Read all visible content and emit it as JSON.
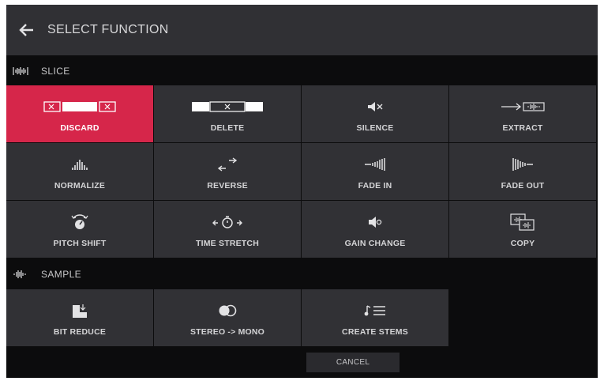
{
  "header": {
    "title": "SELECT FUNCTION",
    "back_icon": "arrow-left-icon"
  },
  "slice": {
    "label": "SLICE",
    "icon": "slice-waveform-icon",
    "items": [
      {
        "label": "DISCARD",
        "icon": "discard-icon",
        "active": true
      },
      {
        "label": "DELETE",
        "icon": "delete-icon"
      },
      {
        "label": "SILENCE",
        "icon": "silence-icon"
      },
      {
        "label": "EXTRACT",
        "icon": "extract-icon"
      },
      {
        "label": "NORMALIZE",
        "icon": "normalize-icon"
      },
      {
        "label": "REVERSE",
        "icon": "reverse-icon"
      },
      {
        "label": "FADE IN",
        "icon": "fade-in-icon"
      },
      {
        "label": "FADE OUT",
        "icon": "fade-out-icon"
      },
      {
        "label": "PITCH SHIFT",
        "icon": "pitch-shift-icon"
      },
      {
        "label": "TIME STRETCH",
        "icon": "time-stretch-icon"
      },
      {
        "label": "GAIN CHANGE",
        "icon": "gain-change-icon"
      },
      {
        "label": "COPY",
        "icon": "copy-icon"
      }
    ]
  },
  "sample": {
    "label": "SAMPLE",
    "icon": "sample-waveform-icon",
    "items": [
      {
        "label": "BIT REDUCE",
        "icon": "bit-reduce-icon"
      },
      {
        "label": "STEREO -> MONO",
        "icon": "stereo-to-mono-icon"
      },
      {
        "label": "CREATE STEMS",
        "icon": "create-stems-icon"
      }
    ]
  },
  "footer": {
    "cancel_label": "CANCEL"
  },
  "colors": {
    "accent": "#d6264a",
    "tile": "#313135",
    "header": "#303034",
    "background": "#0c0c0d"
  }
}
